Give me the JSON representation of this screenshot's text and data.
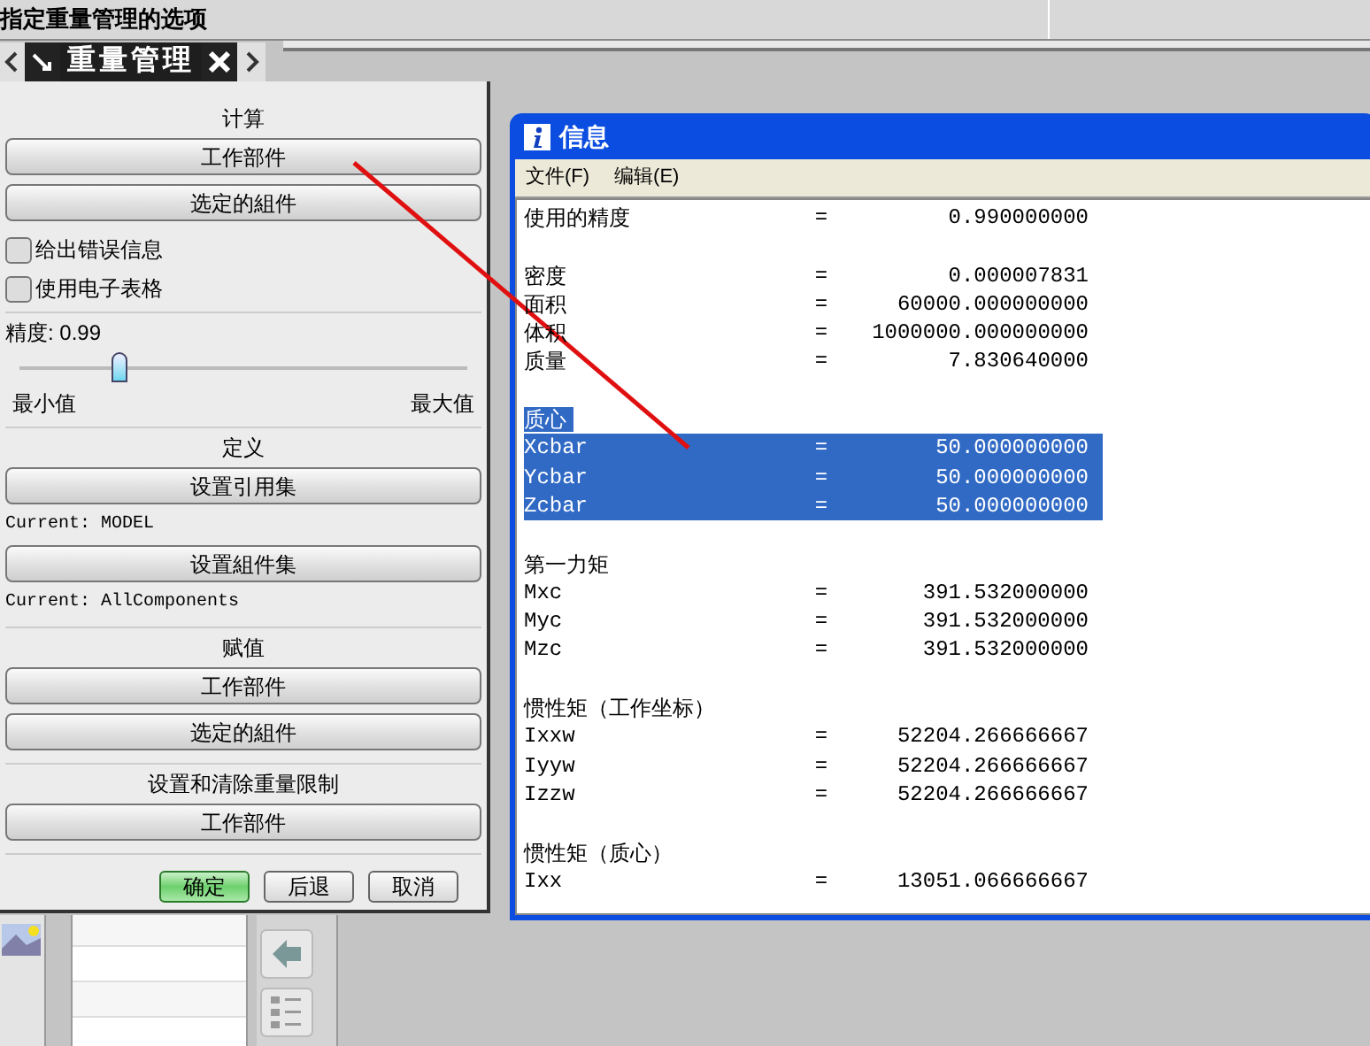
{
  "cue_line": {
    "text": "指定重量管理的选项"
  },
  "panel": {
    "tab_title": "重量管理",
    "items": [
      {
        "kind": "heading",
        "text": "计算"
      },
      {
        "kind": "button",
        "label": "工作部件"
      },
      {
        "kind": "button",
        "label": "选定的組件"
      },
      {
        "kind": "checkbox",
        "label": "给出错误信息",
        "checked": false
      },
      {
        "kind": "checkbox",
        "label": "使用电子表格",
        "checked": false
      },
      {
        "kind": "separator"
      },
      {
        "kind": "slider",
        "label": "精度: 0.99",
        "level": 0.22,
        "min_label": "最小值",
        "max_label": "最大值"
      },
      {
        "kind": "separator"
      },
      {
        "kind": "heading",
        "text": "定义"
      },
      {
        "kind": "button",
        "label": "设置引用集"
      },
      {
        "kind": "note",
        "text": "Current: MODEL"
      },
      {
        "kind": "button",
        "label": "设置組件集"
      },
      {
        "kind": "note",
        "text": "Current: AllComponents"
      },
      {
        "kind": "separator"
      },
      {
        "kind": "heading",
        "text": "赋值"
      },
      {
        "kind": "button",
        "label": "工作部件"
      },
      {
        "kind": "button",
        "label": "选定的組件"
      },
      {
        "kind": "separator"
      },
      {
        "kind": "heading",
        "text": "设置和清除重量限制"
      },
      {
        "kind": "button",
        "label": "工作部件"
      },
      {
        "kind": "separator"
      }
    ],
    "footer_buttons": [
      {
        "label": "确定",
        "default": true
      },
      {
        "label": "后退",
        "default": false
      },
      {
        "label": "取消",
        "default": false
      }
    ]
  },
  "info_window": {
    "title": "信息",
    "menu": [
      "文件(F)",
      "编辑(E)"
    ],
    "lines": [
      {
        "kind": "row",
        "label": "使用的精度",
        "equals": "=",
        "value": "0.990000000",
        "selected": false
      },
      {
        "kind": "blank"
      },
      {
        "kind": "row",
        "label": "密度",
        "equals": "=",
        "value": "0.000007831",
        "selected": false
      },
      {
        "kind": "row",
        "label": "面积",
        "equals": "=",
        "value": "60000.000000000",
        "selected": false
      },
      {
        "kind": "row",
        "label": "体积",
        "equals": "=",
        "value": "1000000.000000000",
        "selected": false
      },
      {
        "kind": "row",
        "label": "质量",
        "equals": "=",
        "value": "7.830640000",
        "selected": false
      },
      {
        "kind": "blank"
      },
      {
        "kind": "heading",
        "text": "质心",
        "selected": true
      },
      {
        "kind": "row",
        "label": "Xcbar",
        "equals": "=",
        "value": "50.000000000",
        "selected": true
      },
      {
        "kind": "row",
        "label": "Ycbar",
        "equals": "=",
        "value": "50.000000000",
        "selected": true
      },
      {
        "kind": "row",
        "label": "Zcbar",
        "equals": "=",
        "value": "50.000000000",
        "selected": true
      },
      {
        "kind": "blank"
      },
      {
        "kind": "heading",
        "text": "第一力矩",
        "selected": false
      },
      {
        "kind": "row",
        "label": "Mxc",
        "equals": "=",
        "value": "391.532000000",
        "selected": false
      },
      {
        "kind": "row",
        "label": "Myc",
        "equals": "=",
        "value": "391.532000000",
        "selected": false
      },
      {
        "kind": "row",
        "label": "Mzc",
        "equals": "=",
        "value": "391.532000000",
        "selected": false
      },
      {
        "kind": "blank"
      },
      {
        "kind": "heading",
        "text": "惯性矩（工作坐标）",
        "selected": false
      },
      {
        "kind": "row",
        "label": "Ixxw",
        "equals": "=",
        "value": "52204.266666667",
        "selected": false
      },
      {
        "kind": "row",
        "label": "Iyyw",
        "equals": "=",
        "value": "52204.266666667",
        "selected": false
      },
      {
        "kind": "row",
        "label": "Izzw",
        "equals": "=",
        "value": "52204.266666667",
        "selected": false
      },
      {
        "kind": "blank"
      },
      {
        "kind": "heading",
        "text": "惯性矩（质心）",
        "selected": false
      },
      {
        "kind": "row",
        "label": "Ixx",
        "equals": "=",
        "value": "13051.066666667",
        "selected": false
      }
    ]
  }
}
